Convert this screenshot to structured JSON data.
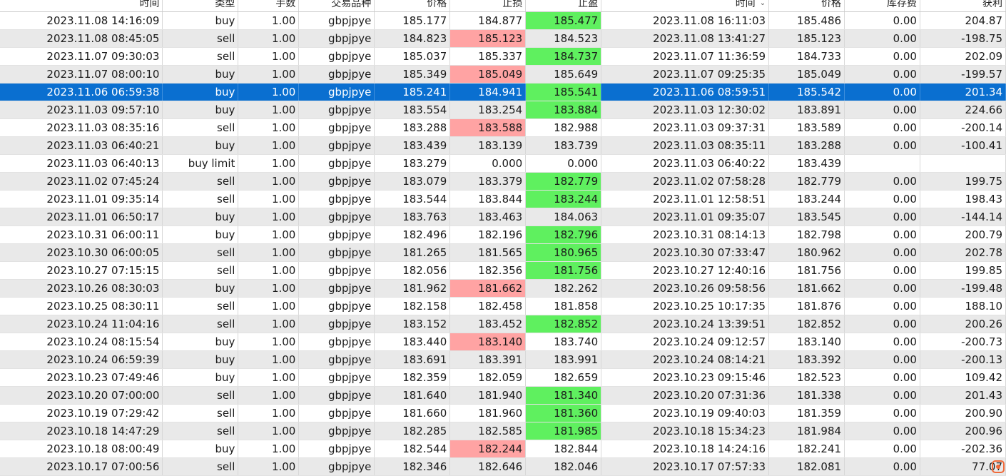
{
  "headers": {
    "time": "时间",
    "type": "类型",
    "volume": "手数",
    "symbol": "交易品种",
    "price": "价格",
    "sl": "止损",
    "tp": "止盈",
    "close_time": "时间",
    "close_price": "价格",
    "swap": "库存费",
    "profit": "获利"
  },
  "colors": {
    "selected_row": "#0a6fd0",
    "stop_loss_hit": "#ffa3a3",
    "take_profit_hit": "#5ff05f",
    "row_alt": "#e9e9e9"
  },
  "rows": [
    {
      "time": "2023.11.08 14:16:09",
      "type": "buy",
      "volume": "1.00",
      "symbol": "gbpjpye",
      "price": "185.177",
      "sl": "184.877",
      "tp": "185.477",
      "close_time": "2023.11.08 16:11:03",
      "close_price": "185.486",
      "swap": "0.00",
      "profit": "204.87",
      "hit": "tp"
    },
    {
      "time": "2023.11.08 08:45:05",
      "type": "sell",
      "volume": "1.00",
      "symbol": "gbpjpye",
      "price": "184.823",
      "sl": "185.123",
      "tp": "184.523",
      "close_time": "2023.11.08 13:41:27",
      "close_price": "185.123",
      "swap": "0.00",
      "profit": "-198.75",
      "hit": "sl"
    },
    {
      "time": "2023.11.07 09:30:03",
      "type": "sell",
      "volume": "1.00",
      "symbol": "gbpjpye",
      "price": "185.037",
      "sl": "185.337",
      "tp": "184.737",
      "close_time": "2023.11.07 11:36:59",
      "close_price": "184.733",
      "swap": "0.00",
      "profit": "202.09",
      "hit": "tp"
    },
    {
      "time": "2023.11.07 08:00:10",
      "type": "buy",
      "volume": "1.00",
      "symbol": "gbpjpye",
      "price": "185.349",
      "sl": "185.049",
      "tp": "185.649",
      "close_time": "2023.11.07 09:25:35",
      "close_price": "185.049",
      "swap": "0.00",
      "profit": "-199.57",
      "hit": "sl"
    },
    {
      "time": "2023.11.06 06:59:38",
      "type": "buy",
      "volume": "1.00",
      "symbol": "gbpjpye",
      "price": "185.241",
      "sl": "184.941",
      "tp": "185.541",
      "close_time": "2023.11.06 08:59:51",
      "close_price": "185.542",
      "swap": "0.00",
      "profit": "201.34",
      "hit": "tp",
      "selected": true
    },
    {
      "time": "2023.11.03 09:57:10",
      "type": "buy",
      "volume": "1.00",
      "symbol": "gbpjpye",
      "price": "183.554",
      "sl": "183.254",
      "tp": "183.884",
      "close_time": "2023.11.03 12:30:02",
      "close_price": "183.891",
      "swap": "0.00",
      "profit": "224.66",
      "hit": "tp"
    },
    {
      "time": "2023.11.03 08:35:16",
      "type": "sell",
      "volume": "1.00",
      "symbol": "gbpjpye",
      "price": "183.288",
      "sl": "183.588",
      "tp": "182.988",
      "close_time": "2023.11.03 09:37:31",
      "close_price": "183.589",
      "swap": "0.00",
      "profit": "-200.14",
      "hit": "sl"
    },
    {
      "time": "2023.11.03 06:40:21",
      "type": "buy",
      "volume": "1.00",
      "symbol": "gbpjpye",
      "price": "183.439",
      "sl": "183.139",
      "tp": "183.739",
      "close_time": "2023.11.03 08:35:11",
      "close_price": "183.288",
      "swap": "0.00",
      "profit": "-100.41",
      "hit": ""
    },
    {
      "time": "2023.11.03 06:40:13",
      "type": "buy limit",
      "volume": "1.00",
      "symbol": "gbpjpye",
      "price": "183.279",
      "sl": "0.000",
      "tp": "0.000",
      "close_time": "2023.11.03 06:40:22",
      "close_price": "183.439",
      "swap": "",
      "profit": "",
      "hit": ""
    },
    {
      "time": "2023.11.02 07:45:24",
      "type": "sell",
      "volume": "1.00",
      "symbol": "gbpjpye",
      "price": "183.079",
      "sl": "183.379",
      "tp": "182.779",
      "close_time": "2023.11.02 07:58:28",
      "close_price": "182.779",
      "swap": "0.00",
      "profit": "199.75",
      "hit": "tp"
    },
    {
      "time": "2023.11.01 09:35:14",
      "type": "sell",
      "volume": "1.00",
      "symbol": "gbpjpye",
      "price": "183.544",
      "sl": "183.844",
      "tp": "183.244",
      "close_time": "2023.11.01 12:58:51",
      "close_price": "183.244",
      "swap": "0.00",
      "profit": "198.43",
      "hit": "tp"
    },
    {
      "time": "2023.11.01 06:50:17",
      "type": "buy",
      "volume": "1.00",
      "symbol": "gbpjpye",
      "price": "183.763",
      "sl": "183.463",
      "tp": "184.063",
      "close_time": "2023.11.01 09:35:07",
      "close_price": "183.545",
      "swap": "0.00",
      "profit": "-144.14",
      "hit": ""
    },
    {
      "time": "2023.10.31 06:00:11",
      "type": "buy",
      "volume": "1.00",
      "symbol": "gbpjpye",
      "price": "182.496",
      "sl": "182.196",
      "tp": "182.796",
      "close_time": "2023.10.31 08:14:13",
      "close_price": "182.798",
      "swap": "0.00",
      "profit": "200.79",
      "hit": "tp"
    },
    {
      "time": "2023.10.30 06:00:05",
      "type": "sell",
      "volume": "1.00",
      "symbol": "gbpjpye",
      "price": "181.265",
      "sl": "181.565",
      "tp": "180.965",
      "close_time": "2023.10.30 07:33:47",
      "close_price": "180.962",
      "swap": "0.00",
      "profit": "202.78",
      "hit": "tp"
    },
    {
      "time": "2023.10.27 07:15:15",
      "type": "sell",
      "volume": "1.00",
      "symbol": "gbpjpye",
      "price": "182.056",
      "sl": "182.356",
      "tp": "181.756",
      "close_time": "2023.10.27 12:40:16",
      "close_price": "181.756",
      "swap": "0.00",
      "profit": "199.85",
      "hit": "tp"
    },
    {
      "time": "2023.10.26 08:30:03",
      "type": "buy",
      "volume": "1.00",
      "symbol": "gbpjpye",
      "price": "181.962",
      "sl": "181.662",
      "tp": "182.262",
      "close_time": "2023.10.26 09:58:56",
      "close_price": "181.662",
      "swap": "0.00",
      "profit": "-199.48",
      "hit": "sl"
    },
    {
      "time": "2023.10.25 08:30:11",
      "type": "sell",
      "volume": "1.00",
      "symbol": "gbpjpye",
      "price": "182.158",
      "sl": "182.458",
      "tp": "181.858",
      "close_time": "2023.10.25 10:17:35",
      "close_price": "181.876",
      "swap": "0.00",
      "profit": "188.10",
      "hit": ""
    },
    {
      "time": "2023.10.24 11:04:16",
      "type": "sell",
      "volume": "1.00",
      "symbol": "gbpjpye",
      "price": "183.152",
      "sl": "183.452",
      "tp": "182.852",
      "close_time": "2023.10.24 13:39:51",
      "close_price": "182.852",
      "swap": "0.00",
      "profit": "200.26",
      "hit": "tp"
    },
    {
      "time": "2023.10.24 08:15:54",
      "type": "buy",
      "volume": "1.00",
      "symbol": "gbpjpye",
      "price": "183.440",
      "sl": "183.140",
      "tp": "183.740",
      "close_time": "2023.10.24 09:12:57",
      "close_price": "183.140",
      "swap": "0.00",
      "profit": "-200.73",
      "hit": "sl"
    },
    {
      "time": "2023.10.24 06:59:39",
      "type": "buy",
      "volume": "1.00",
      "symbol": "gbpjpye",
      "price": "183.691",
      "sl": "183.391",
      "tp": "183.991",
      "close_time": "2023.10.24 08:14:21",
      "close_price": "183.392",
      "swap": "0.00",
      "profit": "-200.13",
      "hit": ""
    },
    {
      "time": "2023.10.23 07:49:46",
      "type": "buy",
      "volume": "1.00",
      "symbol": "gbpjpye",
      "price": "182.359",
      "sl": "182.059",
      "tp": "182.659",
      "close_time": "2023.10.23 09:15:46",
      "close_price": "182.523",
      "swap": "0.00",
      "profit": "109.42",
      "hit": ""
    },
    {
      "time": "2023.10.20 07:00:00",
      "type": "sell",
      "volume": "1.00",
      "symbol": "gbpjpye",
      "price": "181.640",
      "sl": "181.940",
      "tp": "181.340",
      "close_time": "2023.10.20 07:31:36",
      "close_price": "181.338",
      "swap": "0.00",
      "profit": "201.43",
      "hit": "tp"
    },
    {
      "time": "2023.10.19 07:29:42",
      "type": "sell",
      "volume": "1.00",
      "symbol": "gbpjpye",
      "price": "181.660",
      "sl": "181.960",
      "tp": "181.360",
      "close_time": "2023.10.19 09:40:03",
      "close_price": "181.359",
      "swap": "0.00",
      "profit": "200.90",
      "hit": "tp"
    },
    {
      "time": "2023.10.18 14:47:29",
      "type": "sell",
      "volume": "1.00",
      "symbol": "gbpjpye",
      "price": "182.285",
      "sl": "182.585",
      "tp": "181.985",
      "close_time": "2023.10.18 15:34:23",
      "close_price": "181.984",
      "swap": "0.00",
      "profit": "200.96",
      "hit": "tp"
    },
    {
      "time": "2023.10.18 08:00:49",
      "type": "buy",
      "volume": "1.00",
      "symbol": "gbpjpye",
      "price": "182.544",
      "sl": "182.244",
      "tp": "182.844",
      "close_time": "2023.10.18 14:24:16",
      "close_price": "182.241",
      "swap": "0.00",
      "profit": "-202.36",
      "hit": "sl"
    },
    {
      "time": "2023.10.17 07:00:56",
      "type": "sell",
      "volume": "1.00",
      "symbol": "gbpjpye",
      "price": "182.346",
      "sl": "182.646",
      "tp": "182.046",
      "close_time": "2023.10.17 07:57:33",
      "close_price": "182.081",
      "swap": "0.00",
      "profit": "77.07",
      "hit": ""
    }
  ]
}
